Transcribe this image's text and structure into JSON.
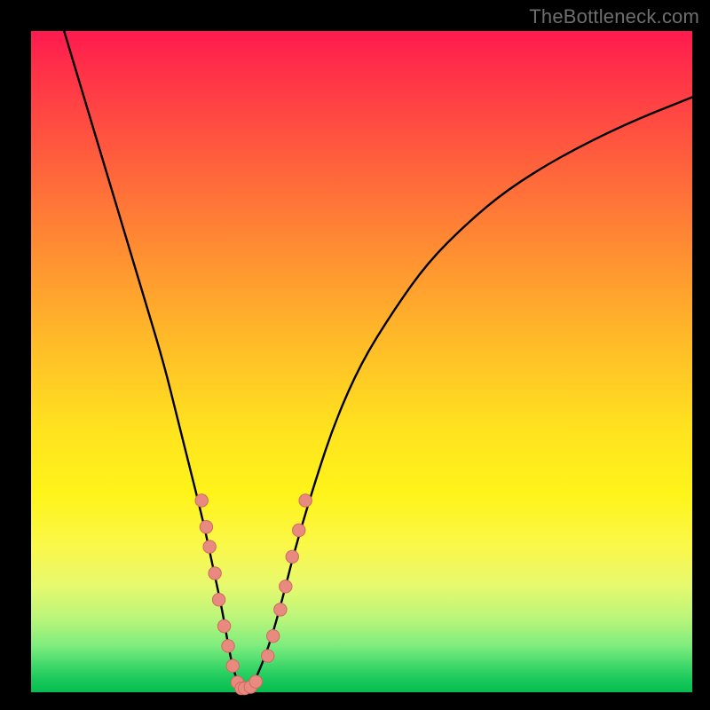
{
  "watermark": "TheBottleneck.com",
  "colors": {
    "background": "#000000",
    "curve_stroke": "#000000",
    "marker_fill": "#e88a7f",
    "marker_stroke": "#d06a5e"
  },
  "chart_data": {
    "type": "line",
    "title": "",
    "xlabel": "",
    "ylabel": "",
    "xlim": [
      0,
      100
    ],
    "ylim": [
      0,
      100
    ],
    "x": [
      5,
      8,
      11,
      14,
      17,
      20,
      22,
      24,
      26,
      27.5,
      29,
      30,
      31,
      32,
      33,
      34,
      36,
      38,
      40,
      43,
      46,
      50,
      55,
      60,
      66,
      72,
      80,
      90,
      100
    ],
    "y": [
      100,
      90,
      80,
      70,
      60,
      50,
      42,
      34,
      26,
      19,
      12,
      6,
      2,
      0.5,
      0.5,
      2,
      7,
      14,
      22,
      32,
      41,
      50,
      58,
      65,
      71,
      76,
      81,
      86,
      90
    ],
    "series": [
      {
        "name": "markers",
        "x": [
          25.8,
          26.5,
          27.0,
          27.8,
          28.4,
          29.2,
          29.8,
          30.5,
          31.2,
          31.8,
          32.3,
          33.2,
          34.0,
          35.8,
          36.6,
          37.7,
          38.5,
          39.5,
          40.5,
          41.5
        ],
        "y": [
          29,
          25,
          22,
          18,
          14,
          10,
          7,
          4,
          1.5,
          0.6,
          0.6,
          0.8,
          1.6,
          5.5,
          8.5,
          12.5,
          16,
          20.5,
          24.5,
          29
        ]
      }
    ]
  }
}
